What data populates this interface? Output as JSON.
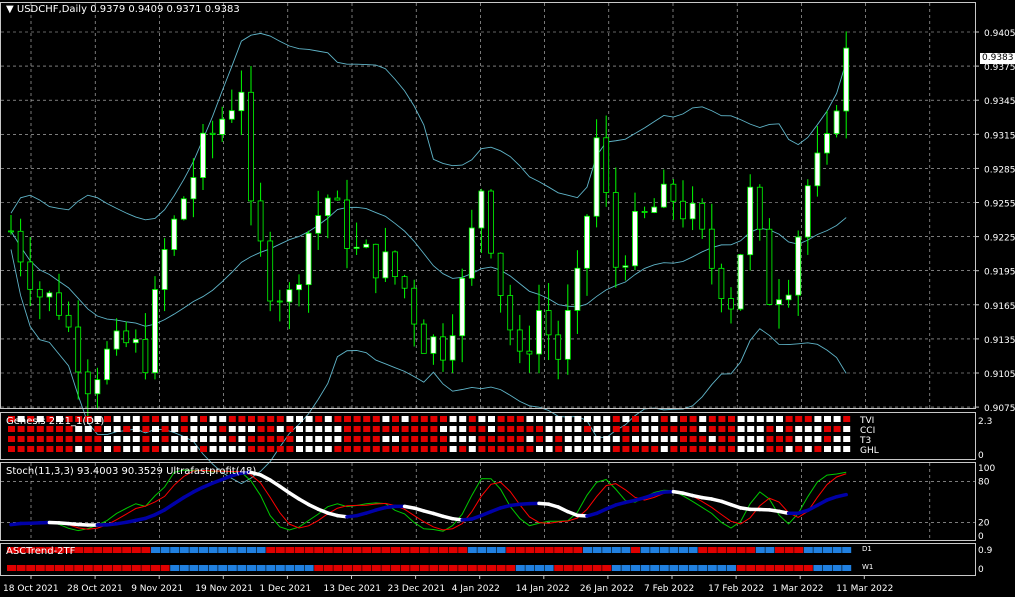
{
  "header": {
    "symbol": "USDCHF,Daily",
    "ohlc": "0.9379 0.9409 0.9371 0.9383",
    "current_price": "0.9383"
  },
  "colors": {
    "background": "#000000",
    "bull_candle": "#ffffff",
    "bear_candle": "#000000",
    "wick": "#00ff00",
    "bands": "#5fb4c8",
    "grid": "#c8c8c8",
    "stoch_main": "#00c800",
    "stoch_signal": "#ff0000",
    "ultra_up": "#ffffff",
    "ultra_down": "#0000a8",
    "dot_red": "#e00000",
    "dot_white": "#ffffff",
    "dot_blue": "#2080e0"
  },
  "main_axis": {
    "labels": [
      "0.9405",
      "0.9375",
      "0.9345",
      "0.9315",
      "0.9285",
      "0.9255",
      "0.9225",
      "0.9195",
      "0.9165",
      "0.9135",
      "0.9105",
      "0.9075"
    ]
  },
  "genesis": {
    "title": "Genesis 2.21_1(D1)",
    "rows": [
      "TVI",
      "CCI",
      "T3",
      "GHL"
    ],
    "scale": [
      "2.3",
      "0"
    ]
  },
  "stoch": {
    "title": "Stoch(11,3,3) 93.4003 90.3529",
    "title2": "Ultrafastprofit(48)",
    "scale": [
      "100",
      "80",
      "20",
      "0"
    ]
  },
  "asc": {
    "title": "ASCTrend-2TF",
    "rows": [
      "D1",
      "W1"
    ],
    "scale": [
      "0.9",
      "0"
    ]
  },
  "time_axis": {
    "labels": [
      "18 Oct 2021",
      "28 Oct 2021",
      "9 Nov 2021",
      "19 Nov 2021",
      "1 Dec 2021",
      "13 Dec 2021",
      "23 Dec 2021",
      "4 Jan 2022",
      "14 Jan 2022",
      "26 Jan 2022",
      "7 Feb 2022",
      "17 Feb 2022",
      "1 Mar 2022",
      "11 Mar 2022"
    ]
  }
}
